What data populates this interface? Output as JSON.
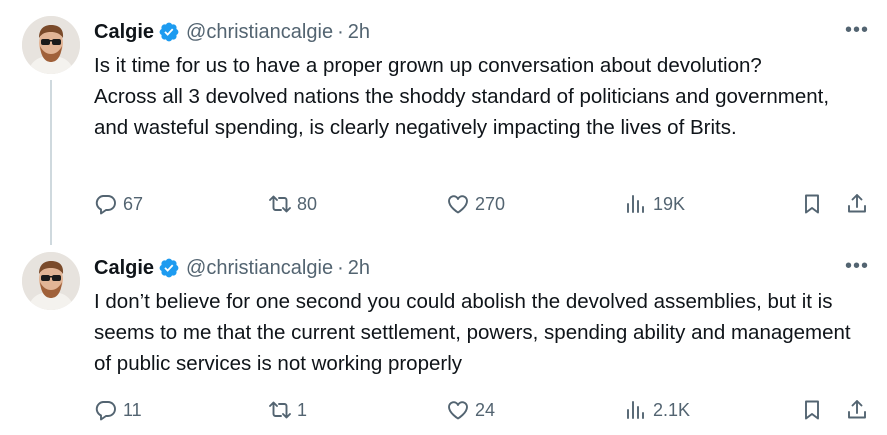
{
  "tweets": [
    {
      "name": "Calgie",
      "handle": "@christiancalgie",
      "separator": "·",
      "time": "2h",
      "more": "•••",
      "text": "Is it time for us to have a proper grown up conversation about devolution?\nAcross all 3 devolved nations the shoddy standard of politicians and government, and wasteful spending, is clearly negatively impacting the lives of Brits.",
      "replies": "67",
      "reposts": "80",
      "likes": "270",
      "views": "19K"
    },
    {
      "name": "Calgie",
      "handle": "@christiancalgie",
      "separator": "·",
      "time": "2h",
      "more": "•••",
      "text": "I don’t believe for one second you could abolish the devolved assemblies, but it is seems to me that the current settlement, powers, spending ability and management of public services is not working properly",
      "replies": "11",
      "reposts": "1",
      "likes": "24",
      "views": "2.1K"
    }
  ],
  "colors": {
    "text": "#0f1419",
    "muted": "#536471",
    "verified": "#1d9bf0",
    "thread_line": "#cfd9de"
  },
  "icons": [
    "reply-icon",
    "repost-icon",
    "like-icon",
    "views-icon",
    "bookmark-icon",
    "share-icon",
    "verified-badge-icon",
    "more-options-icon"
  ]
}
